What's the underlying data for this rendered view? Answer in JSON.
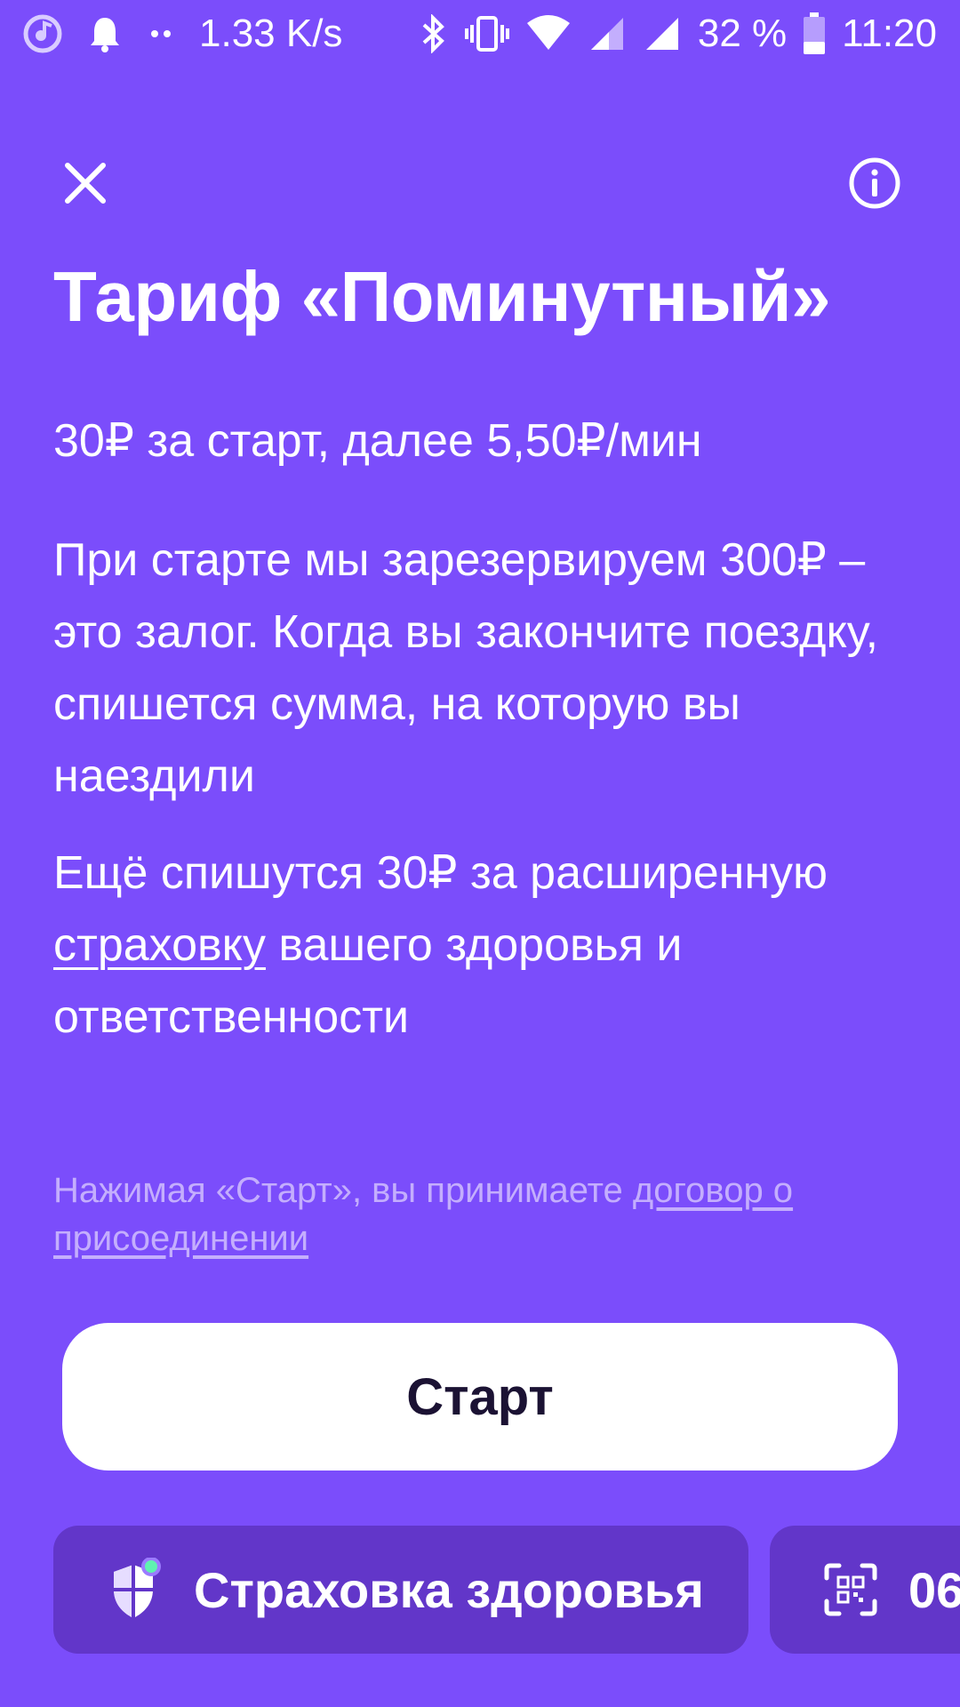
{
  "status_bar": {
    "network_speed": "1.33 K/s",
    "battery_percent": "32 %",
    "time": "11:20",
    "icons": [
      "music-app-icon",
      "notification-bell-icon",
      "more-dots-icon",
      "bluetooth-icon",
      "vibrate-icon",
      "wifi-icon",
      "signal-icon",
      "signal-icon-2",
      "battery-icon"
    ]
  },
  "header": {
    "close_icon": "close-icon",
    "info_icon": "info-icon"
  },
  "tariff": {
    "title": "Тариф «Поминутный»",
    "price_line": "30₽ за старт, далее 5,50₽/мин",
    "deposit_text": "При старте мы зарезервируем 300₽ – это залог. Когда вы закончите поездку, спишется сумма, на которую вы наездили",
    "insurance_prefix": "Ещё спишутся 30₽ за расширенную ",
    "insurance_link": "страховку",
    "insurance_suffix": " вашего здоровья и ответственности"
  },
  "agreement": {
    "prefix": "Нажимая «Старт», вы принимаете ",
    "link": "договор о присоединении"
  },
  "start_button": {
    "label": "Старт"
  },
  "chips": {
    "insurance_label": "Страховка здоровья",
    "scan_label": "06"
  },
  "colors": {
    "background": "#7B4DFB",
    "chip": "#6236C9",
    "button": "#FFFFFF",
    "button_text": "#1B1233",
    "muted_text": "#C4AEFD",
    "badge": "#5FF2B0"
  }
}
